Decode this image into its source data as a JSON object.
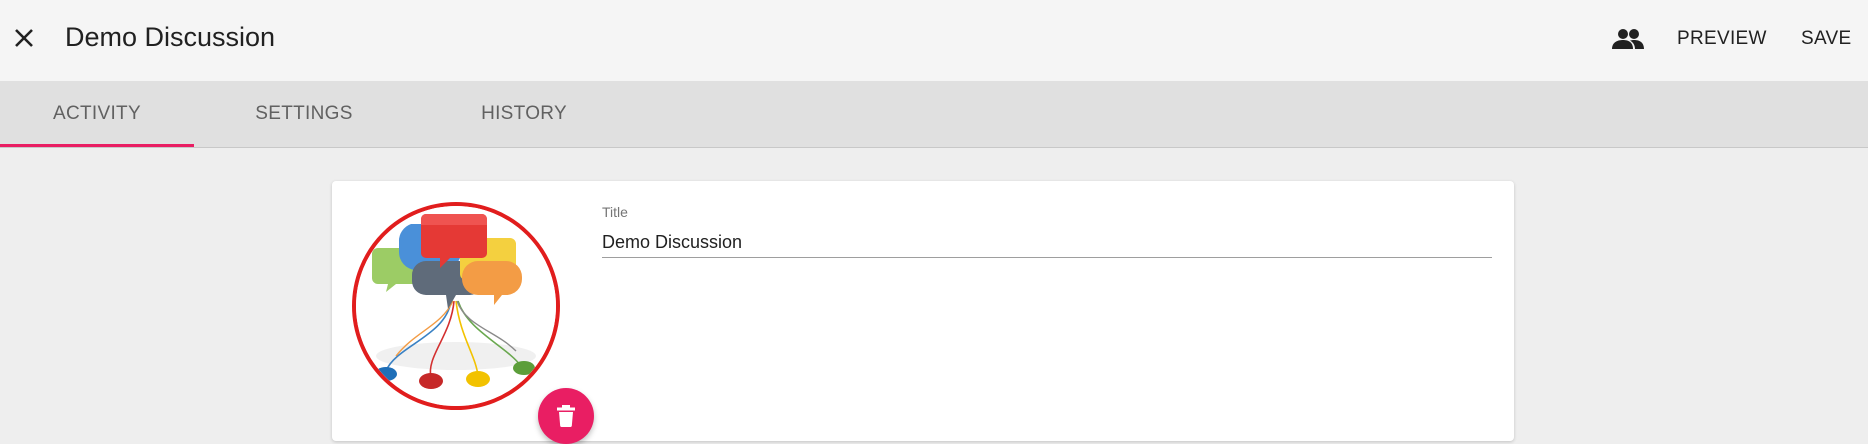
{
  "header": {
    "title": "Demo Discussion",
    "close_icon": "close-icon",
    "participants_icon": "people-icon",
    "preview_label": "PREVIEW",
    "save_label": "SAVE"
  },
  "tabs": {
    "items": [
      {
        "label": "ACTIVITY",
        "active": true
      },
      {
        "label": "SETTINGS",
        "active": false
      },
      {
        "label": "HISTORY",
        "active": false
      }
    ],
    "indicator_color": "#e91e63"
  },
  "form": {
    "title_label": "Title",
    "title_value": "Demo Discussion",
    "image_icon": "discussion-speech-bubbles-image",
    "delete_icon": "trash-icon",
    "avatar_border_color": "#e11d1d",
    "fab_color": "#e91e63"
  }
}
